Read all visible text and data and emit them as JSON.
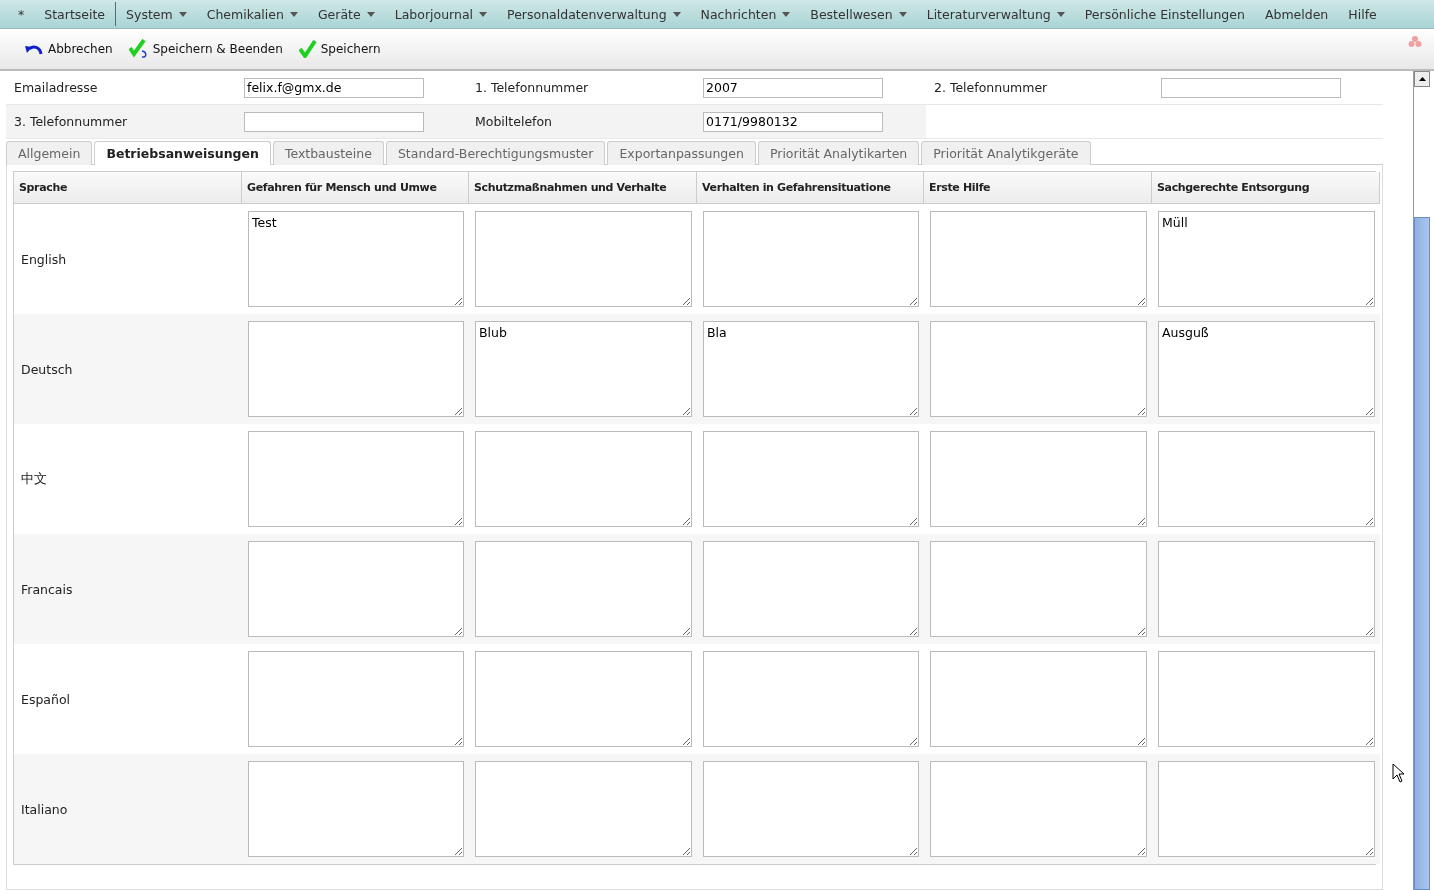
{
  "menu": [
    {
      "label": "*",
      "dropdown": false
    },
    {
      "label": "Startseite",
      "dropdown": false
    },
    {
      "label": "System",
      "dropdown": true
    },
    {
      "label": "Chemikalien",
      "dropdown": true
    },
    {
      "label": "Geräte",
      "dropdown": true
    },
    {
      "label": "Laborjournal",
      "dropdown": true
    },
    {
      "label": "Personaldatenverwaltung",
      "dropdown": true
    },
    {
      "label": "Nachrichten",
      "dropdown": true
    },
    {
      "label": "Bestellwesen",
      "dropdown": true
    },
    {
      "label": "Literaturverwaltung",
      "dropdown": true
    },
    {
      "label": "Persönliche Einstellungen",
      "dropdown": false
    },
    {
      "label": "Abmelden",
      "dropdown": false
    },
    {
      "label": "Hilfe",
      "dropdown": false
    }
  ],
  "toolbar": [
    {
      "label": "Abbrechen",
      "kind": "undo"
    },
    {
      "label": "Speichern & Beenden",
      "kind": "save-close"
    },
    {
      "label": "Speichern",
      "kind": "save"
    }
  ],
  "form_rows": [
    [
      {
        "label": "Emailadresse",
        "value": "felix.f@gmx.de"
      },
      {
        "label": "1. Telefonnummer",
        "value": "2007"
      },
      {
        "label": "2. Telefonnummer"
      }
    ],
    [
      {
        "label": "3. Telefonnummer"
      },
      {
        "label": "Mobiltelefon",
        "value": "0171/9980132"
      }
    ]
  ],
  "tabs": [
    {
      "label": "Allgemein",
      "selected": false
    },
    {
      "label": "Betriebsanweisungen",
      "selected": true
    },
    {
      "label": "Textbausteine",
      "selected": false
    },
    {
      "label": "Standard-Berechtigungsmuster",
      "selected": false
    },
    {
      "label": "Exportanpassungen",
      "selected": false
    },
    {
      "label": "Priorität Analytikarten",
      "selected": false
    },
    {
      "label": "Priorität Analytikgeräte",
      "selected": false
    }
  ],
  "table": {
    "columns": [
      "Sprache",
      "Gefahren für Mensch und Umwe",
      "Schutzmaßnahmen und Verhalte",
      "Verhalten in Gefahrensituatione",
      "Erste Hilfe",
      "Sachgerechte Entsorgung"
    ],
    "rows": [
      {
        "cells": [
          "English",
          "Test",
          null,
          null,
          null,
          "Müll"
        ]
      },
      {
        "cells": [
          "Deutsch",
          null,
          "Blub",
          "Bla",
          null,
          "Ausguß"
        ]
      },
      {
        "cells": [
          "中文",
          null,
          null,
          null,
          null,
          null
        ]
      },
      {
        "cells": [
          "Francais",
          null,
          null,
          null,
          null,
          null
        ]
      },
      {
        "cells": [
          "Español",
          null,
          null,
          null,
          null,
          null
        ]
      },
      {
        "cells": [
          "Italiano",
          null,
          null,
          null,
          null,
          null
        ]
      }
    ]
  }
}
